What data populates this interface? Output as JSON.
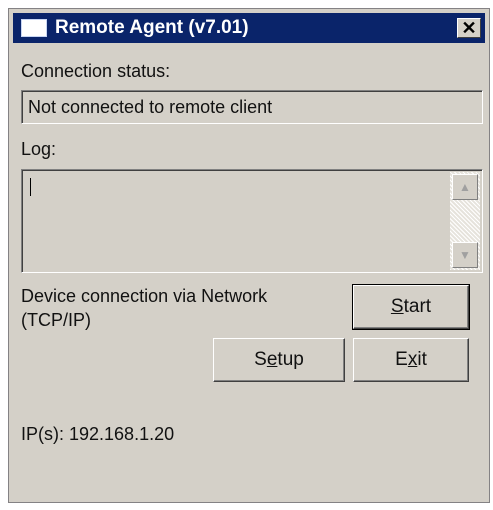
{
  "window": {
    "title": "Remote Agent (v7.01)",
    "close_glyph": "✕"
  },
  "connection": {
    "label": "Connection status:",
    "status_value": "Not connected to remote client"
  },
  "log": {
    "label": "Log:",
    "value": "",
    "scroll_up_icon": "▲",
    "scroll_down_icon": "▼"
  },
  "device": {
    "description_line1": "Device connection via Network",
    "description_line2": "(TCP/IP)"
  },
  "buttons": {
    "start": {
      "pre": "",
      "accel": "S",
      "post": "tart"
    },
    "setup": {
      "pre": "S",
      "accel": "e",
      "post": "tup"
    },
    "exit": {
      "pre": "E",
      "accel": "x",
      "post": "it"
    }
  },
  "network": {
    "ip_text": "IP(s): 192.168.1.20"
  },
  "colors": {
    "titlebar": "#0a246a",
    "window_bg": "#d4d0c8"
  }
}
